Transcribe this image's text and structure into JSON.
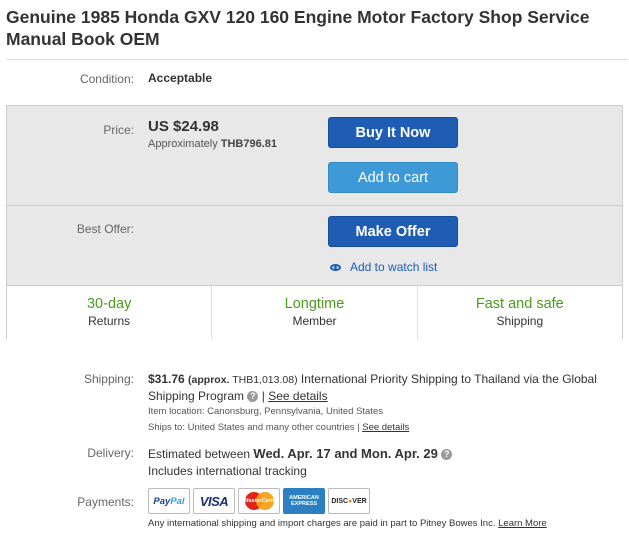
{
  "item": {
    "title": "Genuine 1985 Honda GXV 120 160 Engine Motor Factory Shop Service Manual Book OEM"
  },
  "condition": {
    "label": "Condition:",
    "value": "Acceptable"
  },
  "price": {
    "label": "Price:",
    "value": "US $24.98",
    "approx_prefix": "Approximately",
    "approx_value": "THB796.81"
  },
  "buttons": {
    "buy_now": "Buy It Now",
    "add_to_cart": "Add to cart",
    "make_offer": "Make Offer",
    "watch_list": "Add to watch list"
  },
  "best_offer": {
    "label": "Best Offer:"
  },
  "features": [
    {
      "big": "30-day",
      "small": "Returns"
    },
    {
      "big": "Longtime",
      "small": "Member"
    },
    {
      "big": "Fast and safe",
      "small": "Shipping"
    }
  ],
  "shipping": {
    "label": "Shipping:",
    "cost": "$31.76",
    "approx_prefix": "(approx.",
    "approx_value": "THB1,013.08)",
    "service_text": "International Priority Shipping to Thailand",
    "via_text": "via the Global Shipping Program",
    "see_details": "See details",
    "item_location": "Item location:  Canonsburg, Pennsylvania, United States",
    "ships_to_prefix": "Ships to:  United States and many other countries |",
    "see_details_2": "See details"
  },
  "delivery": {
    "label": "Delivery:",
    "prefix": "Estimated between",
    "dates": "Wed. Apr. 17 and Mon. Apr. 29",
    "tracking": "Includes international tracking"
  },
  "payments": {
    "label": "Payments:",
    "logos": [
      "PayPal",
      "VISA",
      "MasterCard",
      "AMERICAN EXPRESS",
      "DISCOVER"
    ],
    "footnote": "Any international shipping and import charges are paid in part to Pitney Bowes Inc.",
    "learn_more": "Learn More"
  },
  "colors": {
    "primary_button": "#1e5db3",
    "secondary_button": "#3d9ad6",
    "feature_green": "#4a9a1c"
  }
}
